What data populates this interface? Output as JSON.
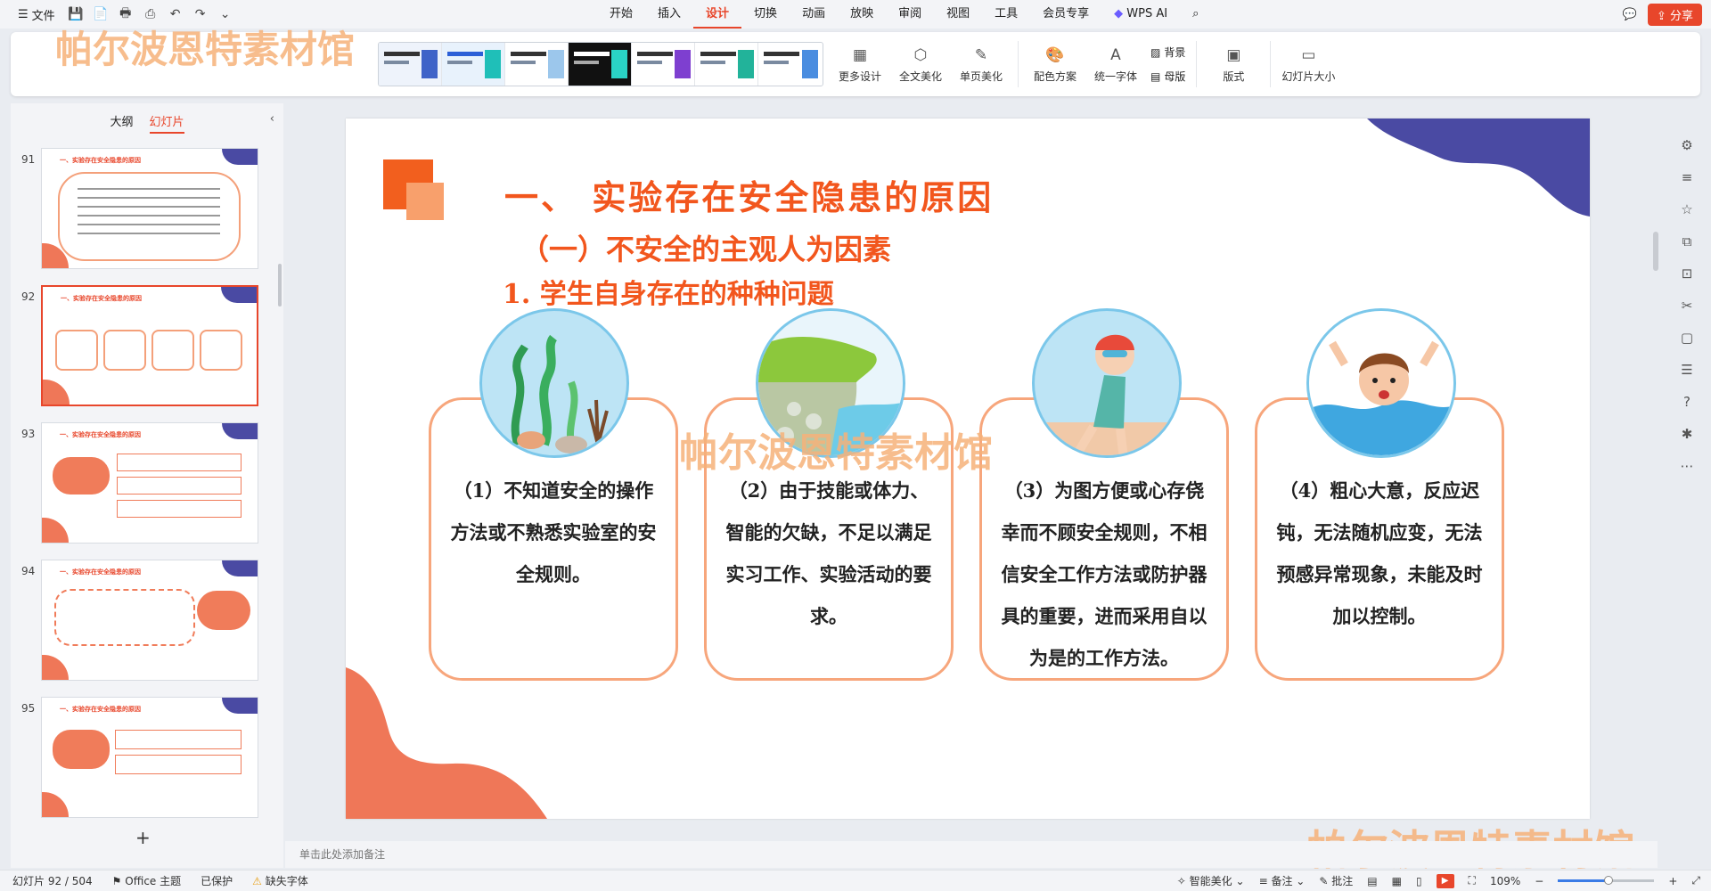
{
  "topbar": {
    "file_label": "文件",
    "tabs": [
      "开始",
      "插入",
      "设计",
      "切换",
      "动画",
      "放映",
      "审阅",
      "视图",
      "工具",
      "会员专享"
    ],
    "active_tab": "设计",
    "wps_ai_label": "WPS AI",
    "share_label": "分享"
  },
  "ribbon": {
    "more_design": "更多设计",
    "full_beautify": "全文美化",
    "single_beautify": "单页美化",
    "color_scheme": "配色方案",
    "unify_font": "统一字体",
    "background": "背景",
    "master": "母版",
    "layout": "版式",
    "slide_size": "幻灯片大小"
  },
  "watermark": "帕尔波恩特素材馆",
  "leftpanel": {
    "tab_outline": "大纲",
    "tab_slides": "幻灯片",
    "thumb_title": "一、实验存在安全隐患的原因",
    "slides": [
      {
        "num": "91"
      },
      {
        "num": "92"
      },
      {
        "num": "93"
      },
      {
        "num": "94"
      },
      {
        "num": "95"
      }
    ],
    "selected": "92"
  },
  "slide": {
    "title": "一、 实验存在安全隐患的原因",
    "subtitle1": "（一）不安全的主观人为因素",
    "subtitle2": "1. 学生自身存在的种种问题",
    "cards": [
      {
        "text": "（1）不知道安全的操作方法或不熟悉实验室的安全规则。"
      },
      {
        "text": "（2）由于技能或体力、智能的欠缺，不足以满足实习工作、实验活动的要求。"
      },
      {
        "text": "（3）为图方便或心存侥幸而不顾安全规则，不相信安全工作方法或防护器具的重要，进而采用自以为是的工作方法。"
      },
      {
        "text": "（4）粗心大意，反应迟钝，无法随机应变，无法预感异常现象，未能及时加以控制。"
      }
    ],
    "colors": {
      "accent": "#f2561d",
      "card_border": "#f7a67c",
      "blob_blue": "#4a4aa3",
      "blob_coral": "#ef7758"
    }
  },
  "notes_placeholder": "单击此处添加备注",
  "status": {
    "slide_counter": "幻灯片 92 / 504",
    "theme": "Office 主题",
    "protected": "已保护",
    "missing_font": "缺失字体",
    "smart_beautify": "智能美化",
    "notes": "备注",
    "comments": "批注",
    "zoom": "109%"
  }
}
